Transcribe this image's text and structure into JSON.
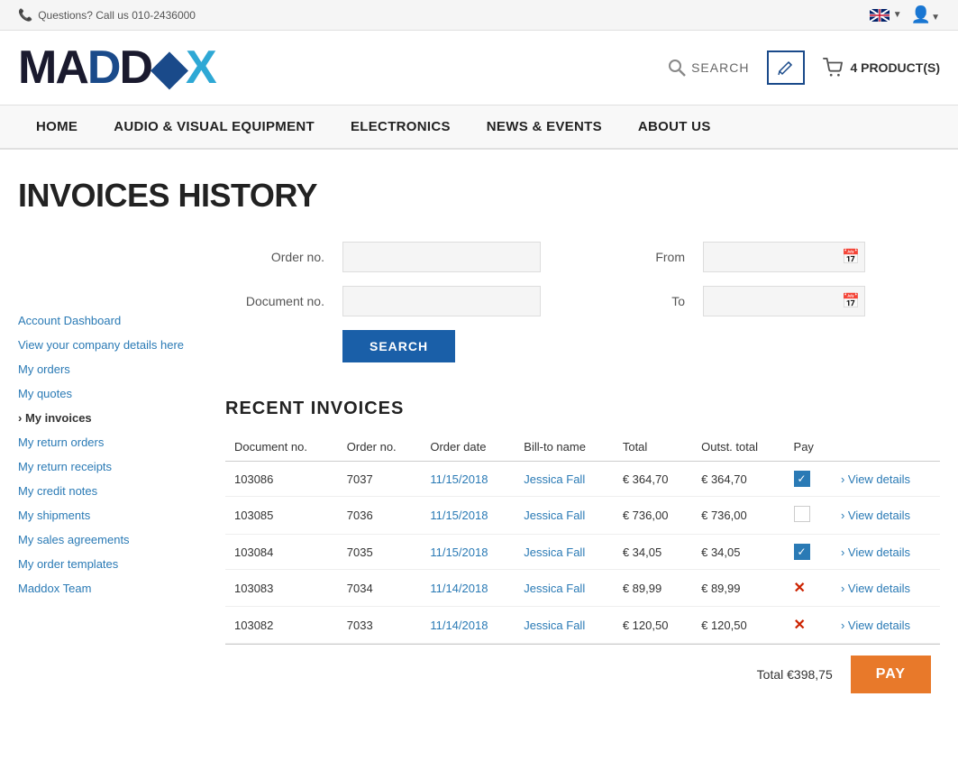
{
  "topbar": {
    "phone_label": "Questions? Call us 010-2436000",
    "flag_alt": "English flag"
  },
  "header": {
    "logo": "MADDOX",
    "search_label": "SEARCH",
    "cart_label": "4 PRODUCT(S)"
  },
  "nav": {
    "items": [
      {
        "label": "HOME",
        "id": "home"
      },
      {
        "label": "AUDIO & VISUAL EQUIPMENT",
        "id": "audio-visual"
      },
      {
        "label": "ELECTRONICS",
        "id": "electronics"
      },
      {
        "label": "NEWS & EVENTS",
        "id": "news-events"
      },
      {
        "label": "ABOUT US",
        "id": "about-us"
      }
    ]
  },
  "page": {
    "title": "INVOICES HISTORY"
  },
  "sidebar": {
    "links": [
      {
        "label": "Account Dashboard",
        "id": "account-dashboard",
        "active": false
      },
      {
        "label": "View your company details here",
        "id": "company-details",
        "active": false
      },
      {
        "label": "My orders",
        "id": "my-orders",
        "active": false
      },
      {
        "label": "My quotes",
        "id": "my-quotes",
        "active": false
      },
      {
        "label": "My invoices",
        "id": "my-invoices",
        "active": true
      },
      {
        "label": "My return orders",
        "id": "my-return-orders",
        "active": false
      },
      {
        "label": "My return receipts",
        "id": "my-return-receipts",
        "active": false
      },
      {
        "label": "My credit notes",
        "id": "my-credit-notes",
        "active": false
      },
      {
        "label": "My shipments",
        "id": "my-shipments",
        "active": false
      },
      {
        "label": "My sales agreements",
        "id": "my-sales-agreements",
        "active": false
      },
      {
        "label": "My order templates",
        "id": "my-order-templates",
        "active": false
      },
      {
        "label": "Maddox Team",
        "id": "maddox-team",
        "active": false
      }
    ]
  },
  "filter": {
    "order_no_label": "Order no.",
    "document_no_label": "Document no.",
    "from_label": "From",
    "to_label": "To",
    "search_button": "SEARCH",
    "order_no_value": "",
    "document_no_value": "",
    "from_value": "",
    "to_value": "",
    "order_no_placeholder": "",
    "document_no_placeholder": "",
    "from_placeholder": "",
    "to_placeholder": ""
  },
  "invoices": {
    "section_title": "RECENT INVOICES",
    "columns": [
      "Document no.",
      "Order no.",
      "Order date",
      "Bill-to name",
      "Total",
      "Outst. total",
      "Pay",
      ""
    ],
    "rows": [
      {
        "doc_no": "103086",
        "order_no": "7037",
        "order_date": "11/15/2018",
        "bill_to": "Jessica Fall",
        "total": "€ 364,70",
        "outst_total": "€ 364,70",
        "pay_status": "checked",
        "view_link": "› View details"
      },
      {
        "doc_no": "103085",
        "order_no": "7036",
        "order_date": "11/15/2018",
        "bill_to": "Jessica Fall",
        "total": "€ 736,00",
        "outst_total": "€ 736,00",
        "pay_status": "empty",
        "view_link": "› View details"
      },
      {
        "doc_no": "103084",
        "order_no": "7035",
        "order_date": "11/15/2018",
        "bill_to": "Jessica Fall",
        "total": "€ 34,05",
        "outst_total": "€ 34,05",
        "pay_status": "checked",
        "view_link": "› View details"
      },
      {
        "doc_no": "103083",
        "order_no": "7034",
        "order_date": "11/14/2018",
        "bill_to": "Jessica Fall",
        "total": "€ 89,99",
        "outst_total": "€ 89,99",
        "pay_status": "x",
        "view_link": "› View details"
      },
      {
        "doc_no": "103082",
        "order_no": "7033",
        "order_date": "11/14/2018",
        "bill_to": "Jessica Fall",
        "total": "€ 120,50",
        "outst_total": "€ 120,50",
        "pay_status": "x",
        "view_link": "› View details"
      }
    ],
    "total_label": "Total €398,75",
    "pay_button": "PAY"
  }
}
